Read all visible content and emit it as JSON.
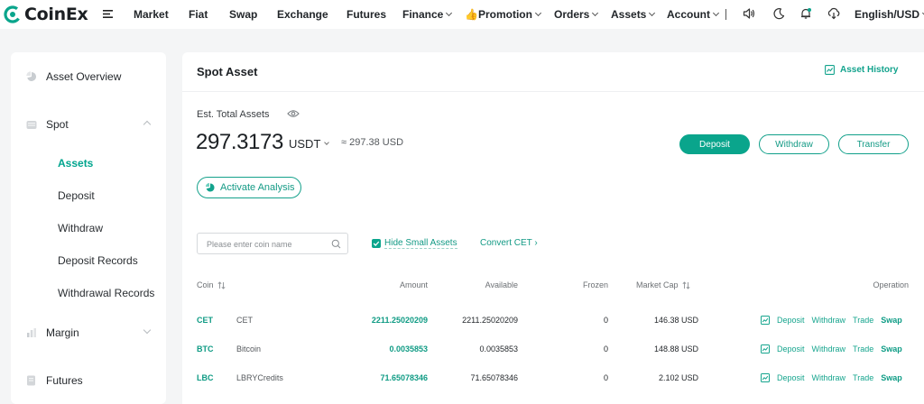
{
  "brand": {
    "name": "CoinEx",
    "accent": "#0aa58c"
  },
  "nav": {
    "items": [
      {
        "label": "Market",
        "caret": false
      },
      {
        "label": "Fiat",
        "caret": false
      },
      {
        "label": "Swap",
        "caret": false
      },
      {
        "label": "Exchange",
        "caret": false
      },
      {
        "label": "Futures",
        "caret": false
      },
      {
        "label": "Finance",
        "caret": true
      },
      {
        "label": "👍Promotion",
        "caret": true
      },
      {
        "label": "Orders",
        "caret": true
      },
      {
        "label": "Assets",
        "caret": true
      },
      {
        "label": "Account",
        "caret": true
      }
    ],
    "language": "English/USD",
    "icons": [
      "menu-icon",
      "speaker-icon",
      "moon-icon",
      "notification-icon",
      "download-icon"
    ]
  },
  "sidebar": {
    "items": [
      {
        "label": "Asset Overview",
        "icon": "pie-chart-icon"
      },
      {
        "label": "Spot",
        "icon": "wallet-icon",
        "expanded": true,
        "children": [
          "Assets",
          "Deposit",
          "Withdraw",
          "Deposit Records",
          "Withdrawal Records"
        ],
        "active": "Assets"
      },
      {
        "label": "Margin",
        "icon": "margin-icon",
        "expanded": false
      },
      {
        "label": "Futures",
        "icon": "futures-icon"
      }
    ]
  },
  "main": {
    "title": "Spot Asset",
    "history_link": "Asset History",
    "est_label": "Est. Total Assets",
    "total_amount": "297.3173",
    "total_unit": "USDT",
    "approx_value": "≈ 297.38 USD",
    "buttons": {
      "deposit": "Deposit",
      "withdraw": "Withdraw",
      "transfer": "Transfer"
    },
    "analysis_button": "Activate Analysis",
    "search": {
      "placeholder": "Please enter coin name",
      "value": ""
    },
    "hide_small": {
      "label": "Hide Small Assets",
      "checked": true
    },
    "convert_link": "Convert CET ›"
  },
  "table": {
    "headers": {
      "coin": "Coin",
      "amount": "Amount",
      "available": "Available",
      "frozen": "Frozen",
      "market_cap": "Market Cap",
      "operation": "Operation"
    },
    "rows": [
      {
        "symbol": "CET",
        "name": "CET",
        "amount": "2211.25020209",
        "available": "2211.25020209",
        "frozen": "0",
        "market_cap": "146.38 USD"
      },
      {
        "symbol": "BTC",
        "name": "Bitcoin",
        "amount": "0.0035853",
        "available": "0.0035853",
        "frozen": "0",
        "market_cap": "148.88 USD"
      },
      {
        "symbol": "LBC",
        "name": "LBRYCredits",
        "amount": "71.65078346",
        "available": "71.65078346",
        "frozen": "0",
        "market_cap": "2.102 USD"
      }
    ],
    "operations": [
      "Deposit",
      "Withdraw",
      "Trade",
      "Swap"
    ]
  }
}
